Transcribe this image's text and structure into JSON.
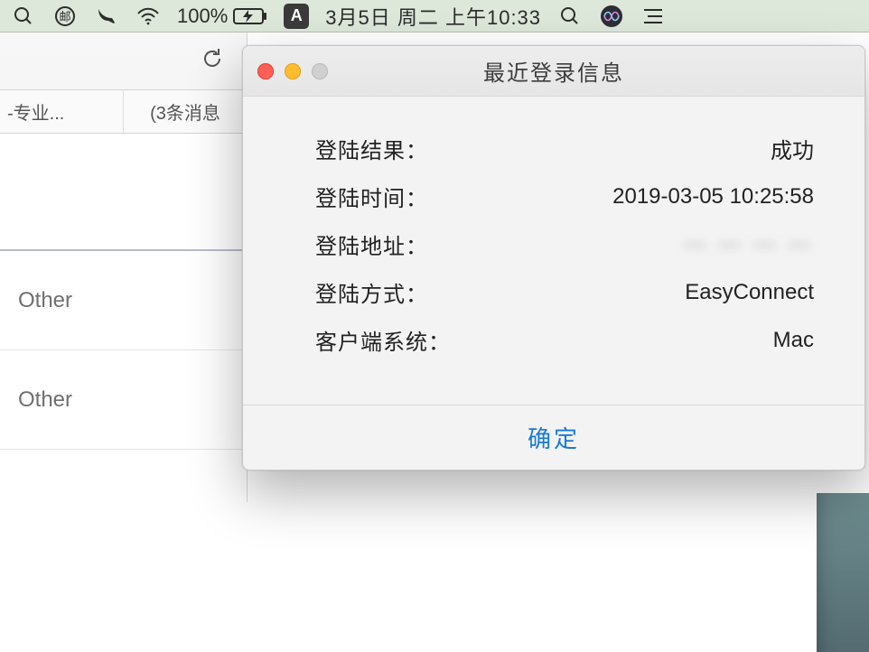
{
  "menubar": {
    "battery_pct": "100%",
    "input_method": "A",
    "date": "3月5日 周二 上午10:33"
  },
  "background": {
    "tab_left": "-专业...",
    "tab_right": "(3条消息",
    "row1": "Other",
    "row2": "Other"
  },
  "dialog": {
    "title": "最近登录信息",
    "labels": {
      "result": "登陆结果：",
      "time": "登陆时间：",
      "addr": "登陆地址：",
      "method": "登陆方式：",
      "client": "客户端系统："
    },
    "values": {
      "result": "成功",
      "time": "2019-03-05 10:25:58",
      "addr": "— — — —",
      "method": "EasyConnect",
      "client": "Mac"
    },
    "ok": "确定"
  }
}
